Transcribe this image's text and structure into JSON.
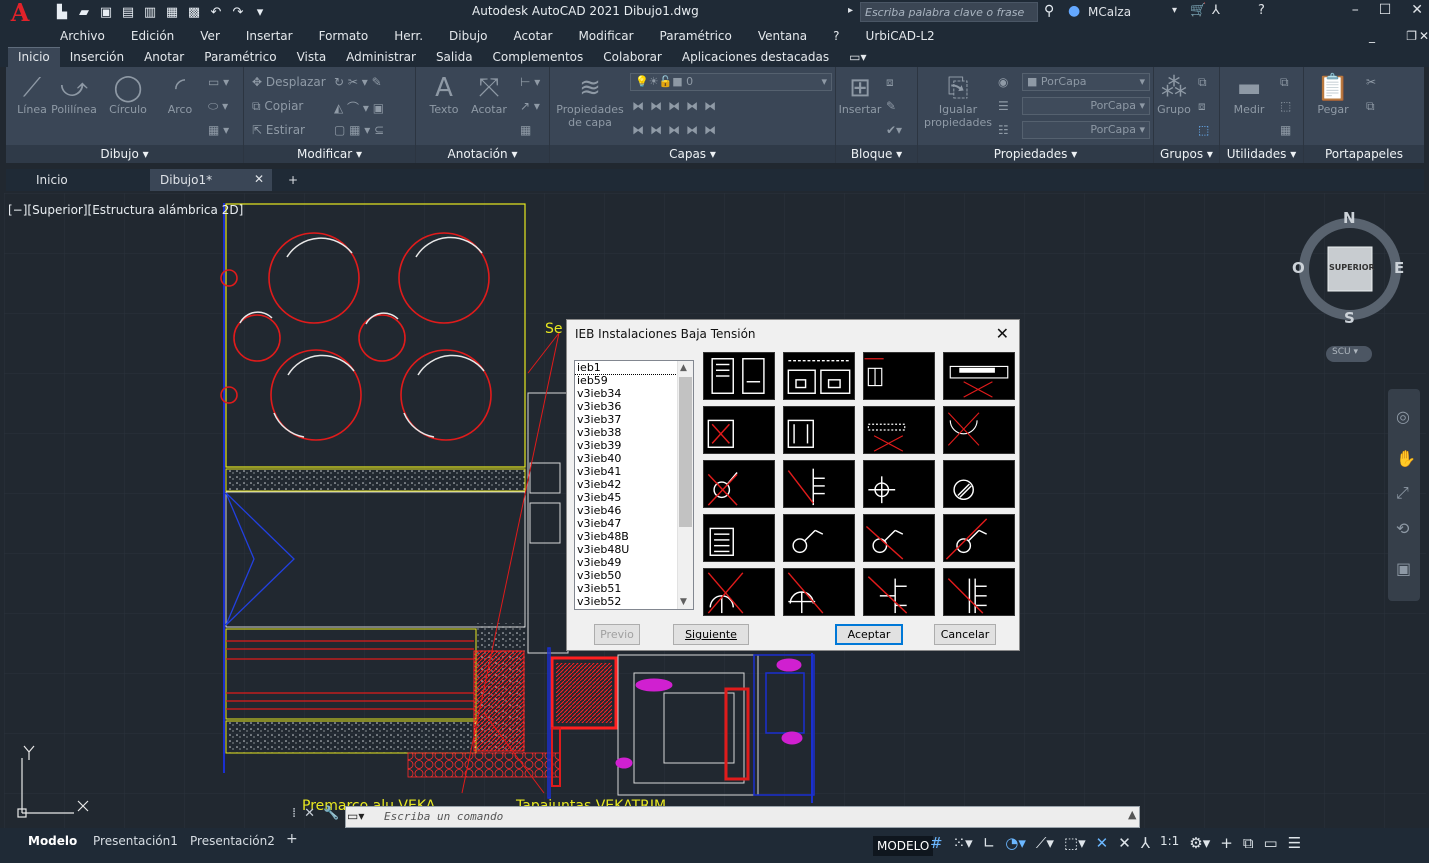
{
  "titlebar": {
    "title": "Autodesk AutoCAD 2021   Dibujo1.dwg",
    "search_placeholder": "Escriba palabra clave o frase",
    "user": "MCalza"
  },
  "menu": [
    "Archivo",
    "Edición",
    "Ver",
    "Insertar",
    "Formato",
    "Herr.",
    "Dibujo",
    "Acotar",
    "Modificar",
    "Paramétrico",
    "Ventana",
    "?",
    "UrbiCAD-L2"
  ],
  "ribbon_tabs": [
    "Inicio",
    "Inserción",
    "Anotar",
    "Paramétrico",
    "Vista",
    "Administrar",
    "Salida",
    "Complementos",
    "Colaborar",
    "Aplicaciones destacadas"
  ],
  "ribbon": {
    "draw": {
      "title": "Dibujo",
      "tools": [
        "Línea",
        "Polilínea",
        "Círculo",
        "Arco"
      ]
    },
    "modify": {
      "title": "Modificar",
      "tools": [
        "Desplazar",
        "Copiar",
        "Estirar"
      ]
    },
    "annotation": {
      "title": "Anotación",
      "tools": [
        "Texto",
        "Acotar"
      ]
    },
    "layers": {
      "title": "Capas",
      "layer_props_1": "Propiedades",
      "layer_props_2": "de capa",
      "current_layer": "0"
    },
    "block": {
      "title": "Bloque",
      "insert": "Insertar"
    },
    "properties": {
      "title": "Propiedades",
      "match_1": "Igualar",
      "match_2": "propiedades",
      "color": "PorCapa",
      "linetype": "PorCapa",
      "lineweight": "PorCapa"
    },
    "groups": {
      "title": "Grupos",
      "group": "Grupo"
    },
    "utilities": {
      "title": "Utilidades",
      "measure": "Medir"
    },
    "clipboard": {
      "title": "Portapapeles",
      "paste": "Pegar"
    }
  },
  "doc_tabs": {
    "start": "Inicio",
    "drawing": "Dibujo1*"
  },
  "viewport": {
    "label": "[−][Superior][Estructura alámbrica 2D]",
    "annotation_1": "Premarco alu VEKA",
    "annotation_2": "Tapajuntas VEKATRIM",
    "annotation_3": "Se"
  },
  "viewcube": {
    "north": "N",
    "south": "S",
    "east": "E",
    "west": "O",
    "face": "SUPERIOR",
    "ucs": "SCU"
  },
  "dialog": {
    "title": "IEB Instalaciones Baja Tensión",
    "list": [
      "ieb1",
      "ieb59",
      "v3ieb34",
      "v3ieb36",
      "v3ieb37",
      "v3ieb38",
      "v3ieb39",
      "v3ieb40",
      "v3ieb41",
      "v3ieb42",
      "v3ieb45",
      "v3ieb46",
      "v3ieb47",
      "v3ieb48B",
      "v3ieb48U",
      "v3ieb49",
      "v3ieb50",
      "v3ieb51",
      "v3ieb52"
    ],
    "btn_prev": "Previo",
    "btn_next": "Siguiente",
    "btn_ok": "Aceptar",
    "btn_cancel": "Cancelar"
  },
  "command": {
    "placeholder": "Escriba un comando"
  },
  "layout_tabs": [
    "Modelo",
    "Presentación1",
    "Presentación2"
  ],
  "status": {
    "mode": "MODELO",
    "scale": "1:1"
  },
  "colors": {
    "accent": "#0078d7",
    "bg": "#212830",
    "ribbon": "#3a4656"
  }
}
